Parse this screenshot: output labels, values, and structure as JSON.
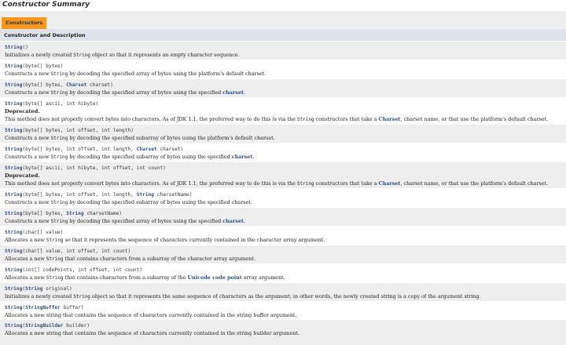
{
  "page": {
    "section_title": "Constructor Summary",
    "tab_label": "Constructors",
    "table_header": "Constructor and Description"
  },
  "rows": [
    {
      "sig": [
        [
          "name",
          "String"
        ],
        [
          "text",
          "()"
        ]
      ],
      "desc": [
        [
          "text",
          "Initializes a newly created "
        ],
        [
          "code",
          "String"
        ],
        [
          "text",
          " object so that it represents an empty character sequence."
        ]
      ]
    },
    {
      "sig": [
        [
          "name",
          "String"
        ],
        [
          "text",
          "(byte[] bytes)"
        ]
      ],
      "desc": [
        [
          "text",
          "Constructs a new "
        ],
        [
          "code",
          "String"
        ],
        [
          "text",
          " by decoding the specified array of bytes using the platform's default charset."
        ]
      ]
    },
    {
      "sig": [
        [
          "name",
          "String"
        ],
        [
          "text",
          "(byte[] bytes, "
        ],
        [
          "type",
          "Charset"
        ],
        [
          "text",
          " charset)"
        ]
      ],
      "desc": [
        [
          "text",
          "Constructs a new "
        ],
        [
          "code",
          "String"
        ],
        [
          "text",
          " by decoding the specified array of bytes using the specified "
        ],
        [
          "link",
          "charset"
        ],
        [
          "text",
          "."
        ]
      ]
    },
    {
      "sig": [
        [
          "name",
          "String"
        ],
        [
          "text",
          "(byte[] ascii, int hibyte)"
        ]
      ],
      "deprecated": "Deprecated.",
      "desc": [
        [
          "text",
          "This method does not properly convert bytes into characters. As of JDK 1.1, the preferred way to do this is via the "
        ],
        [
          "code",
          "String"
        ],
        [
          "text",
          " constructors that take a "
        ],
        [
          "link",
          "Charset"
        ],
        [
          "text",
          ", charset name, or that use the platform's default charset."
        ]
      ]
    },
    {
      "sig": [
        [
          "name",
          "String"
        ],
        [
          "text",
          "(byte[] bytes, int offset, int length)"
        ]
      ],
      "desc": [
        [
          "text",
          "Constructs a new "
        ],
        [
          "code",
          "String"
        ],
        [
          "text",
          " by decoding the specified subarray of bytes using the platform's default charset."
        ]
      ]
    },
    {
      "sig": [
        [
          "name",
          "String"
        ],
        [
          "text",
          "(byte[] bytes, int offset, int length, "
        ],
        [
          "type",
          "Charset"
        ],
        [
          "text",
          " charset)"
        ]
      ],
      "desc": [
        [
          "text",
          "Constructs a new "
        ],
        [
          "code",
          "String"
        ],
        [
          "text",
          " by decoding the specified subarray of bytes using the specified "
        ],
        [
          "link",
          "charset"
        ],
        [
          "text",
          "."
        ]
      ]
    },
    {
      "sig": [
        [
          "name",
          "String"
        ],
        [
          "text",
          "(byte[] ascii, int hibyte, int offset, int count)"
        ]
      ],
      "deprecated": "Deprecated.",
      "desc": [
        [
          "text",
          "This method does not properly convert bytes into characters. As of JDK 1.1, the preferred way to do this is via the "
        ],
        [
          "code",
          "String"
        ],
        [
          "text",
          " constructors that take a "
        ],
        [
          "link",
          "Charset"
        ],
        [
          "text",
          ", charset name, or that use the platform's default charset."
        ]
      ]
    },
    {
      "sig": [
        [
          "name",
          "String"
        ],
        [
          "text",
          "(byte[] bytes, int offset, int length, "
        ],
        [
          "type",
          "String"
        ],
        [
          "text",
          " charsetName)"
        ]
      ],
      "desc": [
        [
          "text",
          "Constructs a new "
        ],
        [
          "code",
          "String"
        ],
        [
          "text",
          " by decoding the specified subarray of bytes using the specified charset."
        ]
      ]
    },
    {
      "sig": [
        [
          "name",
          "String"
        ],
        [
          "text",
          "(byte[] bytes, "
        ],
        [
          "type",
          "String"
        ],
        [
          "text",
          " charsetName)"
        ]
      ],
      "desc": [
        [
          "text",
          "Constructs a new "
        ],
        [
          "code",
          "String"
        ],
        [
          "text",
          " by decoding the specified array of bytes using the specified "
        ],
        [
          "link",
          "charset"
        ],
        [
          "text",
          "."
        ]
      ]
    },
    {
      "sig": [
        [
          "name",
          "String"
        ],
        [
          "text",
          "(char[] value)"
        ]
      ],
      "desc": [
        [
          "text",
          "Allocates a new "
        ],
        [
          "code",
          "String"
        ],
        [
          "text",
          " so that it represents the sequence of characters currently contained in the character array argument."
        ]
      ]
    },
    {
      "sig": [
        [
          "name",
          "String"
        ],
        [
          "text",
          "(char[] value, int offset, int count)"
        ]
      ],
      "desc": [
        [
          "text",
          "Allocates a new "
        ],
        [
          "code",
          "String"
        ],
        [
          "text",
          " that contains characters from a subarray of the character array argument."
        ]
      ]
    },
    {
      "sig": [
        [
          "name",
          "String"
        ],
        [
          "text",
          "(int[] codePoints, int offset, int count)"
        ]
      ],
      "desc": [
        [
          "text",
          "Allocates a new "
        ],
        [
          "code",
          "String"
        ],
        [
          "text",
          " that contains characters from a subarray of the "
        ],
        [
          "link",
          "Unicode code point"
        ],
        [
          "text",
          " array argument."
        ]
      ]
    },
    {
      "sig": [
        [
          "name",
          "String"
        ],
        [
          "text",
          "("
        ],
        [
          "type",
          "String"
        ],
        [
          "text",
          " original)"
        ]
      ],
      "desc": [
        [
          "text",
          "Initializes a newly created "
        ],
        [
          "code",
          "String"
        ],
        [
          "text",
          " object so that it represents the same sequence of characters as the argument; in other words, the newly created string is a copy of the argument string."
        ]
      ]
    },
    {
      "sig": [
        [
          "name",
          "String"
        ],
        [
          "text",
          "("
        ],
        [
          "type",
          "StringBuffer"
        ],
        [
          "text",
          " buffer)"
        ]
      ],
      "desc": [
        [
          "text",
          "Allocates a new string that contains the sequence of characters currently contained in the string buffer argument."
        ]
      ]
    },
    {
      "sig": [
        [
          "name",
          "String"
        ],
        [
          "text",
          "("
        ],
        [
          "type",
          "StringBuilder"
        ],
        [
          "text",
          " builder)"
        ]
      ],
      "desc": [
        [
          "text",
          "Allocates a new string that contains the sequence of characters currently contained in the string builder argument."
        ]
      ]
    }
  ]
}
